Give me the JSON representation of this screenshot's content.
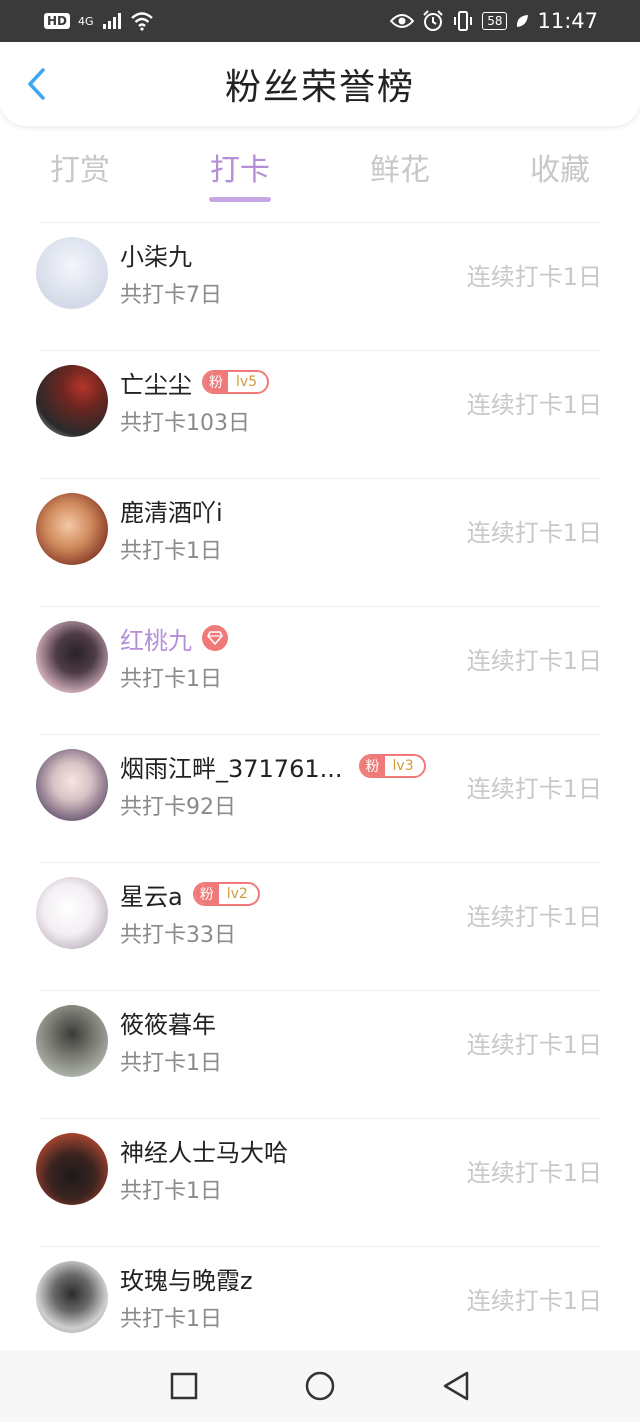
{
  "status_bar": {
    "hd": "HD",
    "network": "4G",
    "battery": "58",
    "time": "11:47"
  },
  "header": {
    "title": "粉丝荣誉榜",
    "back_icon": "chevron-left-icon",
    "accent": "#3ea6f2"
  },
  "tabs": [
    {
      "label": "打赏",
      "active": false
    },
    {
      "label": "打卡",
      "active": true
    },
    {
      "label": "鲜花",
      "active": false
    },
    {
      "label": "收藏",
      "active": false
    }
  ],
  "colors": {
    "accent_purple": "#b48ed6",
    "badge_red": "#f07a7a"
  },
  "fans": [
    {
      "name": "小柒九",
      "total": "共打卡7日",
      "streak": "连续打卡1日",
      "badge": null
    },
    {
      "name": "亡尘尘",
      "total": "共打卡103日",
      "streak": "连续打卡1日",
      "badge": {
        "fan": "粉",
        "level": "lv5"
      }
    },
    {
      "name": "鹿清酒吖i",
      "total": "共打卡1日",
      "streak": "连续打卡1日",
      "badge": null
    },
    {
      "name": "红桃九",
      "total": "共打卡1日",
      "streak": "连续打卡1日",
      "badge": "diamond"
    },
    {
      "name": "烟雨江畔_371761...",
      "total": "共打卡92日",
      "streak": "连续打卡1日",
      "badge": {
        "fan": "粉",
        "level": "lv3"
      }
    },
    {
      "name": "星云a",
      "total": "共打卡33日",
      "streak": "连续打卡1日",
      "badge": {
        "fan": "粉",
        "level": "lv2"
      }
    },
    {
      "name": "筱筱暮年",
      "total": "共打卡1日",
      "streak": "连续打卡1日",
      "badge": null
    },
    {
      "name": "神经人士马大哈",
      "total": "共打卡1日",
      "streak": "连续打卡1日",
      "badge": null
    },
    {
      "name": "玫瑰与晚霞z",
      "total": "共打卡1日",
      "streak": "连续打卡1日",
      "badge": null
    }
  ],
  "nav_bar": {
    "recent_icon": "square-icon",
    "home_icon": "circle-icon",
    "back_icon": "triangle-back-icon"
  }
}
